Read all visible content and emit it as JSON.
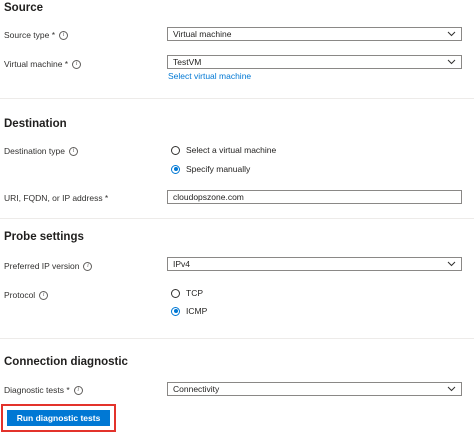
{
  "source": {
    "title": "Source",
    "source_type_label": "Source type *",
    "source_type_value": "Virtual machine",
    "vm_label": "Virtual machine *",
    "vm_value": "TestVM",
    "select_vm_link": "Select virtual machine"
  },
  "destination": {
    "title": "Destination",
    "type_label": "Destination type",
    "options": [
      "Select a virtual machine",
      "Specify manually"
    ],
    "selected": "Specify manually",
    "address_label": "URI, FQDN, or IP address *",
    "address_value": "cloudopszone.com"
  },
  "probe": {
    "title": "Probe settings",
    "ip_version_label": "Preferred IP version",
    "ip_version_value": "IPv4",
    "protocol_label": "Protocol",
    "protocol_options": [
      "TCP",
      "ICMP"
    ],
    "protocol_selected": "ICMP"
  },
  "diagnostic": {
    "title": "Connection diagnostic",
    "tests_label": "Diagnostic tests *",
    "tests_value": "Connectivity",
    "run_button": "Run diagnostic tests"
  },
  "icons": {
    "info": "info-icon",
    "dropdown": "chevron-down-icon"
  },
  "colors": {
    "accent": "#0078d4",
    "highlight_border": "#e3322b"
  }
}
